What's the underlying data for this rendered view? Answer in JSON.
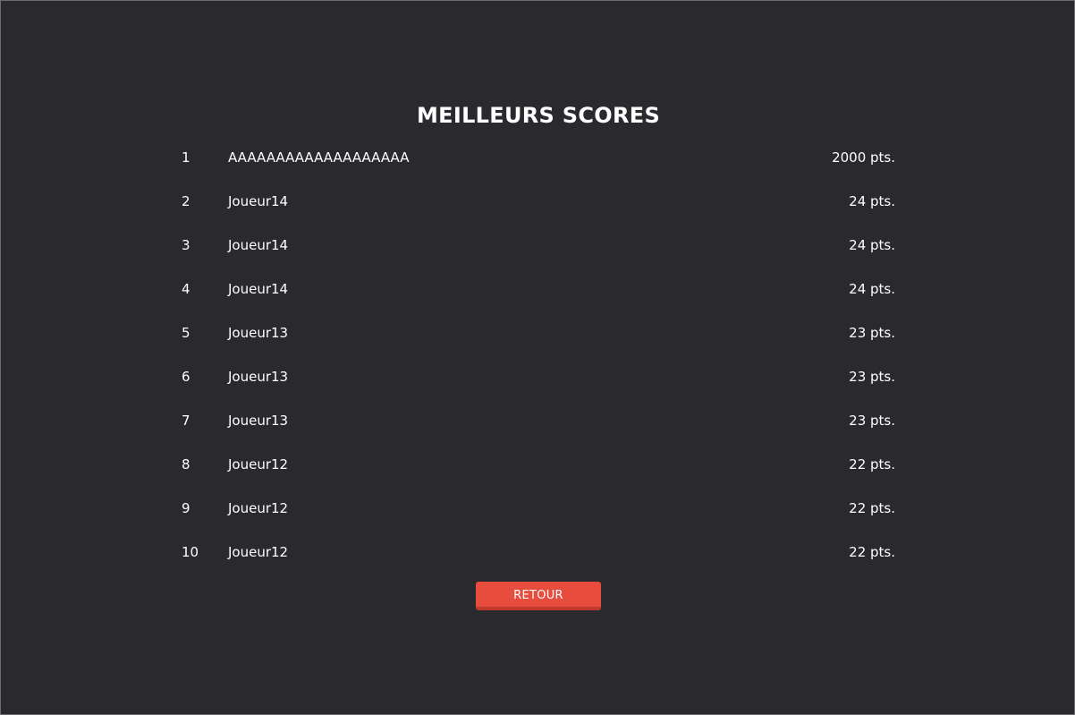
{
  "title": "MEILLEURS SCORES",
  "scores": [
    {
      "rank": "1",
      "name": "AAAAAAAAAAAAAAAAAAA",
      "points": "2000 pts."
    },
    {
      "rank": "2",
      "name": "Joueur14",
      "points": "24 pts."
    },
    {
      "rank": "3",
      "name": "Joueur14",
      "points": "24 pts."
    },
    {
      "rank": "4",
      "name": "Joueur14",
      "points": "24 pts."
    },
    {
      "rank": "5",
      "name": "Joueur13",
      "points": "23 pts."
    },
    {
      "rank": "6",
      "name": "Joueur13",
      "points": "23 pts."
    },
    {
      "rank": "7",
      "name": "Joueur13",
      "points": "23 pts."
    },
    {
      "rank": "8",
      "name": "Joueur12",
      "points": "22 pts."
    },
    {
      "rank": "9",
      "name": "Joueur12",
      "points": "22 pts."
    },
    {
      "rank": "10",
      "name": "Joueur12",
      "points": "22 pts."
    }
  ],
  "back_button": {
    "label": "RETOUR"
  },
  "colors": {
    "background": "#29292e",
    "text": "#ffffff",
    "button": "#e74c3c",
    "button_shadow": "#c0392b"
  }
}
